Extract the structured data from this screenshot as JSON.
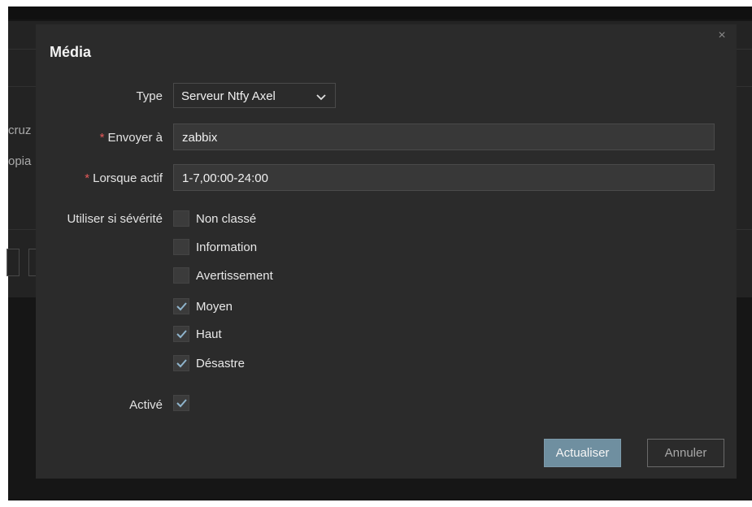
{
  "background": {
    "partial_texts": [
      "cruz",
      "opia"
    ]
  },
  "dialog": {
    "title": "Média",
    "close_symbol": "×",
    "type": {
      "label": "Type",
      "value": "Serveur Ntfy Axel"
    },
    "send_to": {
      "required_mark": "*",
      "label": "Envoyer à",
      "value": "zabbix"
    },
    "when_active": {
      "required_mark": "*",
      "label": "Lorsque actif",
      "value": "1-7,00:00-24:00"
    },
    "severity": {
      "label": "Utiliser si sévérité",
      "options": [
        {
          "label": "Non classé",
          "checked": false
        },
        {
          "label": "Information",
          "checked": false
        },
        {
          "label": "Avertissement",
          "checked": false
        },
        {
          "label": "Moyen",
          "checked": true
        },
        {
          "label": "Haut",
          "checked": true
        },
        {
          "label": "Désastre",
          "checked": true
        }
      ]
    },
    "enabled": {
      "label": "Activé",
      "checked": true
    },
    "buttons": {
      "update": "Actualiser",
      "cancel": "Annuler"
    }
  },
  "icons": {
    "close": "close-icon",
    "dropdown": "chevron-down-icon",
    "check": "checkmark-icon"
  },
  "colors": {
    "modal_bg": "#2b2b2b",
    "primary_button": "#6f8fa0",
    "required": "#e45959",
    "checkmark": "#8fb4cc"
  }
}
